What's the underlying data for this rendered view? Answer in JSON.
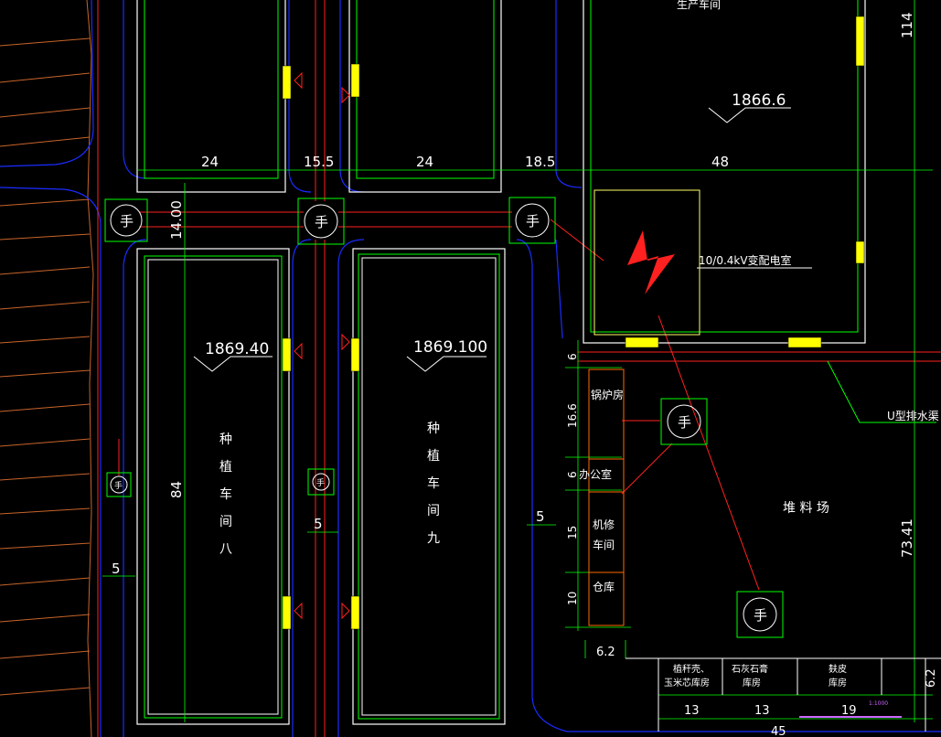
{
  "drawing": {
    "colors": {
      "background": "#000000",
      "road_edge": "#1a2cff",
      "building": "#ffffff",
      "wall_green": "#00ff00",
      "dimension": "#00ff00",
      "cable_red": "#ff2020",
      "door_yellow": "#ffff00",
      "outline_yellow": "#ffff66",
      "room_orange": "#ff6a00",
      "text_white": "#ffffff",
      "scale_magenta": "#cc66ff"
    },
    "top_labels": {
      "workshop_top": "生产车间"
    },
    "dimensions": {
      "d24a": "24",
      "d15_5": "15.5",
      "d24b": "24",
      "d18_5": "18.5",
      "d48": "48",
      "d14_00": "14.00",
      "d84": "84",
      "d5a": "5",
      "d5b": "5",
      "d5c": "5",
      "d114": "114",
      "d73_41": "73.41",
      "d6a": "6",
      "d16_6": "16.6",
      "d6b": "6",
      "d15": "15",
      "d10": "10",
      "d6_2a": "6.2",
      "d6_2b": "6.2",
      "d13a": "13",
      "d13b": "13",
      "d19": "19",
      "d45": "45"
    },
    "elevations": {
      "e1": "1866.6",
      "e2": "1869.40",
      "e3": "1869.100"
    },
    "buildings": {
      "b8_name": [
        "种",
        "植",
        "车",
        "间",
        "八"
      ],
      "b9_name": [
        "种",
        "植",
        "车",
        "间",
        "九"
      ]
    },
    "substation": {
      "label": "10/0.4kV变配电室"
    },
    "drain_label": "U型排水渠",
    "rooms": {
      "boiler": "锅炉房",
      "office": "办公室",
      "repair_1": "机修",
      "repair_2": "车间",
      "warehouse": "仓库"
    },
    "yard_label": "堆 料 场",
    "bottom_table": {
      "c1_line1": "植秆壳、",
      "c1_line2": "玉米芯库房",
      "c2_line1": "石灰石膏",
      "c2_line2": "库房",
      "c3_line1": "麸皮",
      "c3_line2": "库房"
    },
    "scale_text": "1:1000",
    "hand_symbol": "手"
  }
}
